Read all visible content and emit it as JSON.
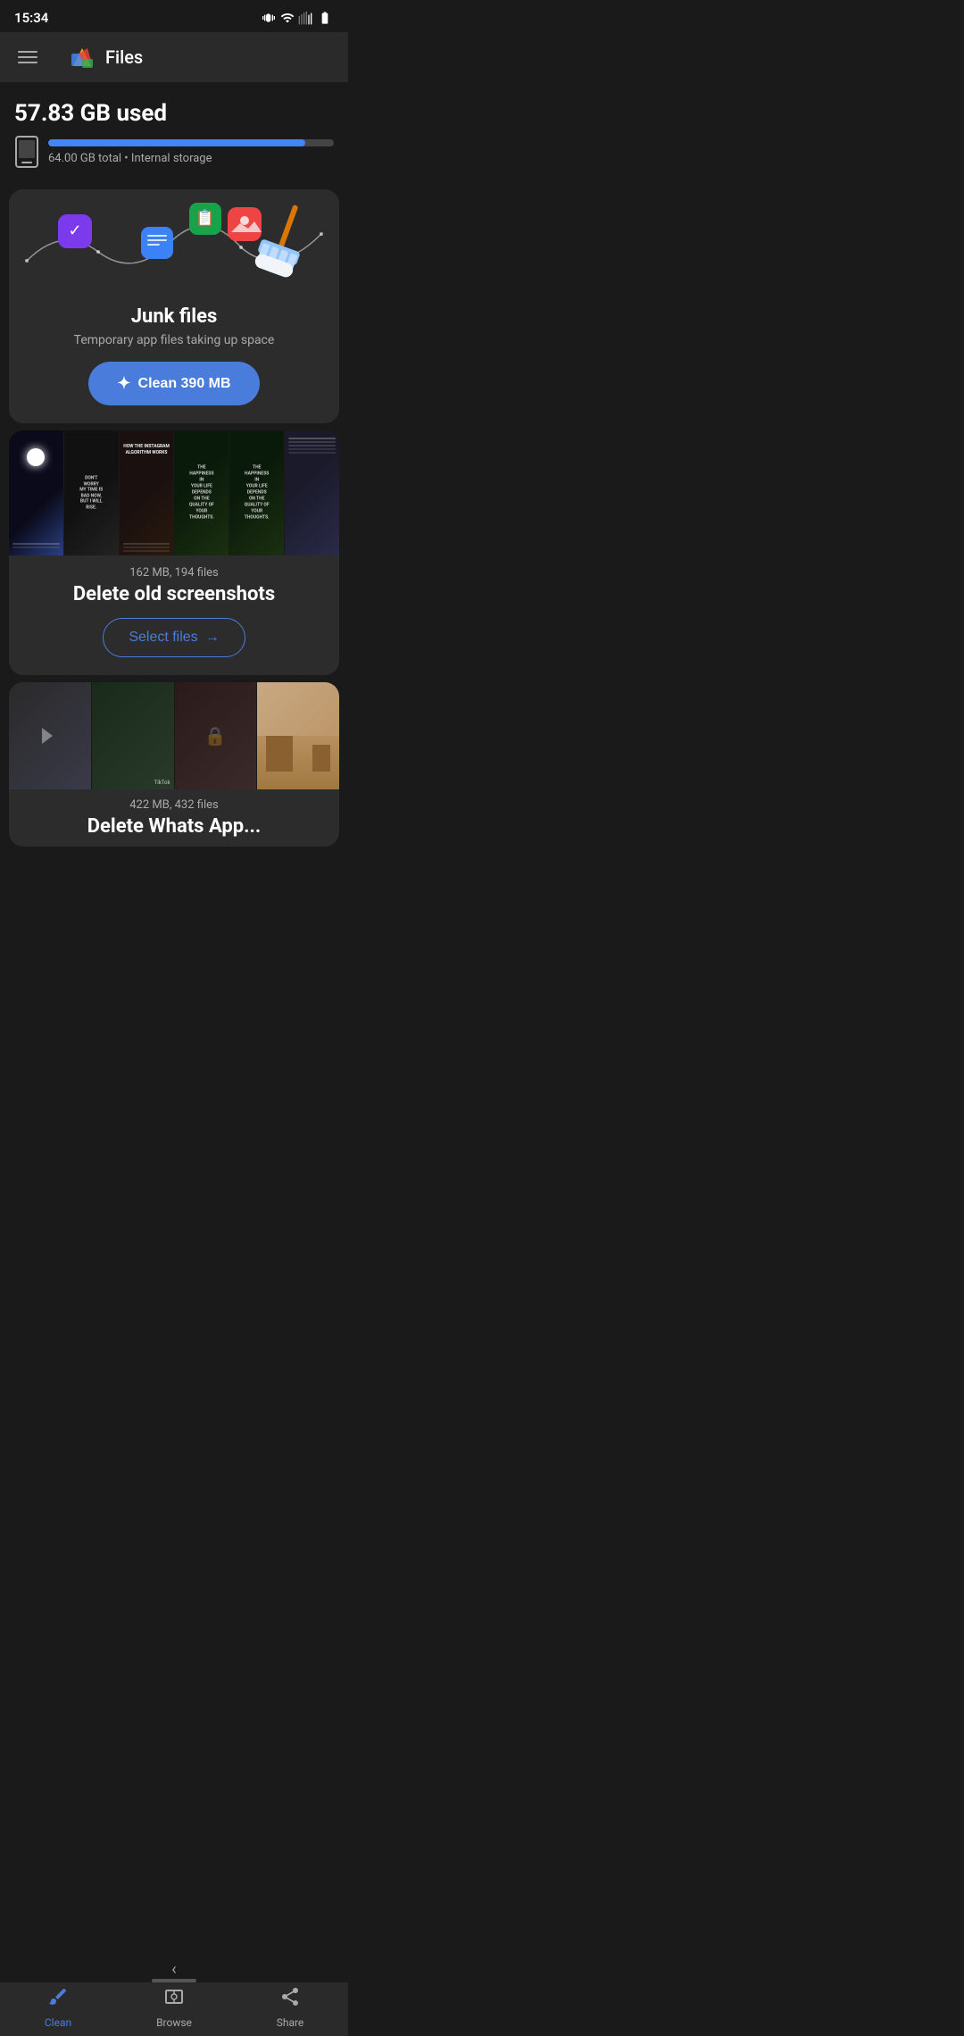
{
  "statusBar": {
    "time": "15:34"
  },
  "topNav": {
    "appTitle": "Files"
  },
  "storage": {
    "used": "57.83 GB used",
    "total": "64.00 GB total • Internal storage",
    "fillPercent": 90
  },
  "junkCard": {
    "title": "Junk files",
    "subtitle": "Temporary app files taking up space",
    "buttonLabel": "Clean 390 MB"
  },
  "screenshotsCard": {
    "stats": "162 MB, 194 files",
    "heading": "Delete old screenshots",
    "buttonLabel": "Select files",
    "buttonArrow": "→"
  },
  "videosCard": {
    "stats": "422 MB, 432 files",
    "headingPartial": "Delete Whats App..."
  },
  "bottomNav": {
    "items": [
      {
        "id": "clean",
        "label": "Clean",
        "active": true
      },
      {
        "id": "browse",
        "label": "Browse",
        "active": false
      },
      {
        "id": "share",
        "label": "Share",
        "active": false
      }
    ]
  }
}
